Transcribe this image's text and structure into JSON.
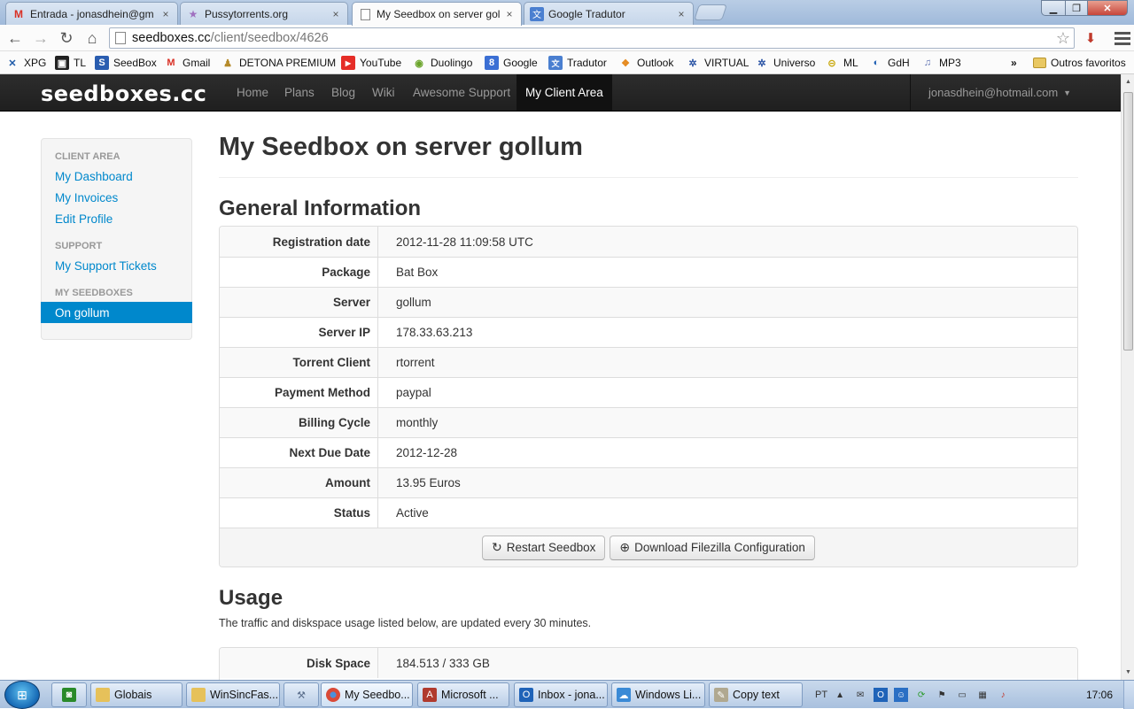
{
  "browser": {
    "tabs": [
      {
        "title": "Entrada - jonasdhein@gm",
        "icon": "gmail-icon",
        "active": false
      },
      {
        "title": "Pussytorrents.org",
        "icon": "star-icon",
        "active": false
      },
      {
        "title": "My Seedbox on server goll",
        "icon": "page-icon",
        "active": true
      },
      {
        "title": "Google Tradutor",
        "icon": "translate-icon",
        "active": false
      }
    ],
    "tab_close_glyph": "×",
    "url_host": "seedboxes.cc",
    "url_path": "/client/seedbox/4626",
    "bookmarks": [
      {
        "label": "XPG",
        "icon": "xpg-icon",
        "color": "#1d5aa8"
      },
      {
        "label": "TL",
        "icon": "tl-icon",
        "color": "#222222"
      },
      {
        "label": "SeedBox",
        "icon": "seedbox-icon",
        "color": "#2a5db0"
      },
      {
        "label": "Gmail",
        "icon": "gmail-icon",
        "color": "#d93025"
      },
      {
        "label": "DETONA PREMIUM",
        "icon": "detona-icon",
        "color": "#b58a2a"
      },
      {
        "label": "YouTube",
        "icon": "youtube-icon",
        "color": "#e52d27"
      },
      {
        "label": "Duolingo",
        "icon": "duolingo-icon",
        "color": "#6aa42a"
      },
      {
        "label": "Google",
        "icon": "google-icon",
        "color": "#3b6fd4"
      },
      {
        "label": "Tradutor",
        "icon": "translate-icon",
        "color": "#4a7fd0"
      },
      {
        "label": "Outlook",
        "icon": "outlook-icon",
        "color": "#e58a1f"
      },
      {
        "label": "VIRTUAL",
        "icon": "virtual-icon",
        "color": "#2d56a6"
      },
      {
        "label": "Universo",
        "icon": "universo-icon",
        "color": "#2d56a6"
      },
      {
        "label": "ML",
        "icon": "ml-icon",
        "color": "#e8c413"
      },
      {
        "label": "GdH",
        "icon": "gdh-icon",
        "color": "#1e5fb3"
      },
      {
        "label": "MP3",
        "icon": "mp3-icon",
        "color": "#5b6fb0"
      }
    ],
    "bookmarks_overflow": "»",
    "other_bookmarks": "Outros favoritos"
  },
  "site": {
    "logo": "seedboxes.cc",
    "nav": [
      {
        "label": "Home",
        "active": false
      },
      {
        "label": "Plans",
        "active": false
      },
      {
        "label": "Blog",
        "active": false
      },
      {
        "label": "Wiki",
        "active": false
      },
      {
        "label": "Awesome Support",
        "active": false
      },
      {
        "label": "My Client Area",
        "active": true
      }
    ],
    "user_email": "jonasdhein@hotmail.com"
  },
  "sidebar": {
    "sections": [
      {
        "header": "CLIENT AREA",
        "items": [
          {
            "label": "My Dashboard",
            "active": false
          },
          {
            "label": "My Invoices",
            "active": false
          },
          {
            "label": "Edit Profile",
            "active": false
          }
        ]
      },
      {
        "header": "SUPPORT",
        "items": [
          {
            "label": "My Support Tickets",
            "active": false
          }
        ]
      },
      {
        "header": "MY SEEDBOXES",
        "items": [
          {
            "label": "On gollum",
            "active": true
          }
        ]
      }
    ]
  },
  "main": {
    "title": "My Seedbox on server gollum",
    "general": {
      "heading": "General Information",
      "rows": [
        {
          "label": "Registration date",
          "value": "2012-11-28 11:09:58 UTC"
        },
        {
          "label": "Package",
          "value": "Bat Box"
        },
        {
          "label": "Server",
          "value": "gollum"
        },
        {
          "label": "Server IP",
          "value": "178.33.63.213"
        },
        {
          "label": "Torrent Client",
          "value": "rtorrent"
        },
        {
          "label": "Payment Method",
          "value": "paypal"
        },
        {
          "label": "Billing Cycle",
          "value": "monthly"
        },
        {
          "label": "Next Due Date",
          "value": "2012-12-28"
        },
        {
          "label": "Amount",
          "value": "13.95 Euros"
        },
        {
          "label": "Status",
          "value": "Active"
        }
      ],
      "restart_label": "Restart Seedbox",
      "download_label": "Download Filezilla Configuration"
    },
    "usage": {
      "heading": "Usage",
      "description": "The traffic and diskspace usage listed below, are updated every 30 minutes.",
      "rows": [
        {
          "label": "Disk Space",
          "value": "184.513 / 333 GB"
        }
      ]
    }
  },
  "taskbar": {
    "items": [
      {
        "label": "",
        "icon": "app-pinned-icon",
        "color": "#2a8a2a",
        "pinned": true
      },
      {
        "label": "Globais",
        "icon": "folder-icon",
        "color": "#e6c15a"
      },
      {
        "label": "WinSincFas...",
        "icon": "winsinc-icon",
        "color": "#e6c15a"
      },
      {
        "label": "",
        "icon": "tool-icon",
        "color": "#5a6e8c",
        "pinned": true
      },
      {
        "label": "My Seedbo...",
        "icon": "chrome-icon",
        "color": "#d94a38"
      },
      {
        "label": "Microsoft ...",
        "icon": "access-icon",
        "color": "#b03a2e"
      },
      {
        "label": "Inbox - jona...",
        "icon": "outlook-icon",
        "color": "#1f63b8"
      },
      {
        "label": "Windows Li...",
        "icon": "windows-live-icon",
        "color": "#3a8ad6"
      },
      {
        "label": "Copy text",
        "icon": "copy-icon",
        "color": "#b0a890"
      }
    ],
    "language": "PT",
    "clock": "17:06"
  }
}
